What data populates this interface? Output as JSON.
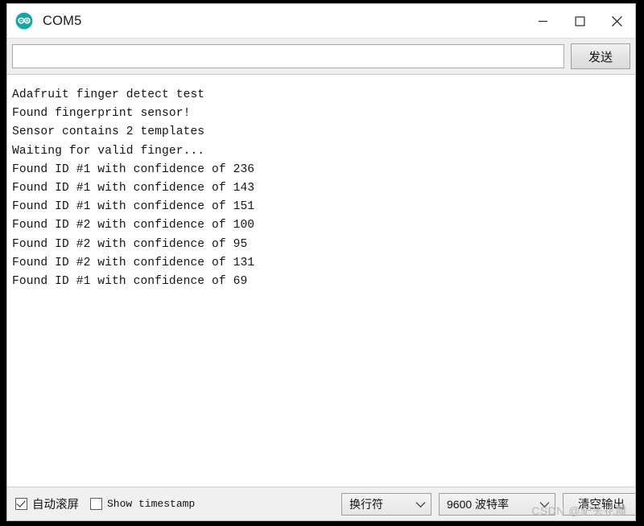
{
  "window": {
    "title": "COM5",
    "icon": "arduino-logo-icon",
    "accent_color": "#1aa3a3",
    "controls": {
      "minimize": "minimize-icon",
      "maximize": "maximize-icon",
      "close": "close-icon"
    }
  },
  "send_row": {
    "input_value": "",
    "input_placeholder": "",
    "send_label": "发送"
  },
  "console": {
    "lines": [
      "Adafruit finger detect test",
      "Found fingerprint sensor!",
      "Sensor contains 2 templates",
      "Waiting for valid finger...",
      "Found ID #1 with confidence of 236",
      "Found ID #1 with confidence of 143",
      "Found ID #1 with confidence of 151",
      "Found ID #2 with confidence of 100",
      "Found ID #2 with confidence of 95",
      "Found ID #2 with confidence of 131",
      "Found ID #1 with confidence of 69"
    ]
  },
  "status_bar": {
    "autoscroll_label": "自动滚屏",
    "autoscroll_checked": true,
    "timestamp_label": "Show timestamp",
    "timestamp_checked": false,
    "newline_value": "换行符",
    "baud_value": "9600 波特率",
    "clear_label": "清空输出"
  },
  "watermark": {
    "text": "CSDN @驴头花雕"
  }
}
